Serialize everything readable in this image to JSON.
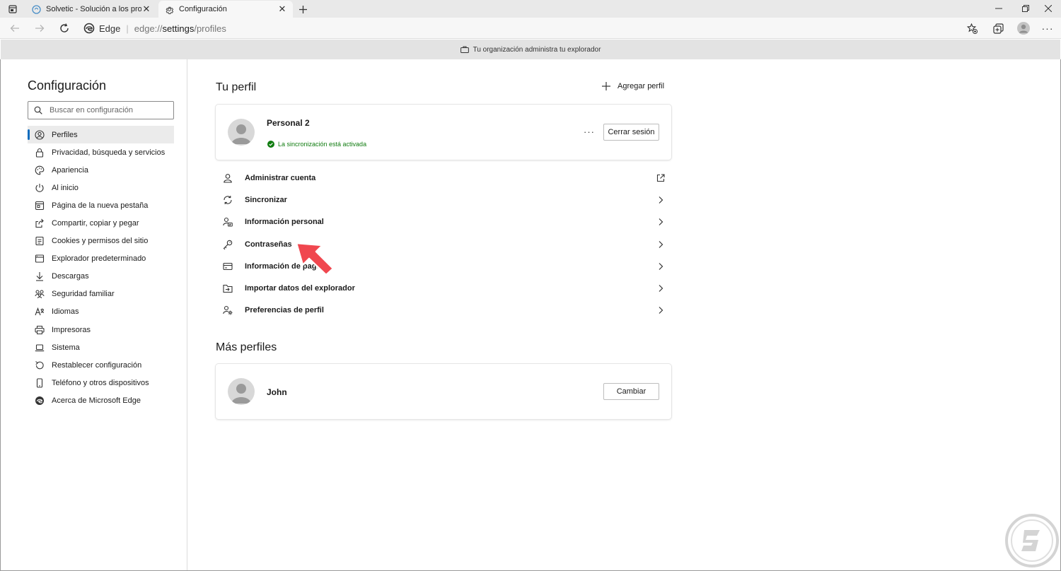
{
  "tabs": [
    {
      "title": "Solvetic - Solución a los problem",
      "active": false
    },
    {
      "title": "Configuración",
      "active": true
    }
  ],
  "toolbar": {
    "brand": "Edge",
    "url_prefix": "edge://",
    "url_host": "settings",
    "url_path": "/profiles"
  },
  "managed_bar": {
    "text": "Tu organización administra tu explorador"
  },
  "sidebar": {
    "title": "Configuración",
    "search_placeholder": "Buscar en configuración",
    "items": [
      {
        "label": "Perfiles",
        "icon": "profile-icon",
        "selected": true
      },
      {
        "label": "Privacidad, búsqueda y servicios",
        "icon": "lock-icon"
      },
      {
        "label": "Apariencia",
        "icon": "appearance-icon"
      },
      {
        "label": "Al inicio",
        "icon": "power-icon"
      },
      {
        "label": "Página de la nueva pestaña",
        "icon": "newtab-icon"
      },
      {
        "label": "Compartir, copiar y pegar",
        "icon": "share-icon"
      },
      {
        "label": "Cookies y permisos del sitio",
        "icon": "cookies-icon"
      },
      {
        "label": "Explorador predeterminado",
        "icon": "browser-icon"
      },
      {
        "label": "Descargas",
        "icon": "download-icon"
      },
      {
        "label": "Seguridad familiar",
        "icon": "family-icon"
      },
      {
        "label": "Idiomas",
        "icon": "languages-icon"
      },
      {
        "label": "Impresoras",
        "icon": "printer-icon"
      },
      {
        "label": "Sistema",
        "icon": "laptop-icon"
      },
      {
        "label": "Restablecer configuración",
        "icon": "reset-icon"
      },
      {
        "label": "Teléfono y otros dispositivos",
        "icon": "phone-icon"
      },
      {
        "label": "Acerca de Microsoft Edge",
        "icon": "edge-logo-icon"
      }
    ]
  },
  "main": {
    "profile_heading": "Tu perfil",
    "add_profile_label": "Agregar perfil",
    "current_profile": {
      "name": "Personal 2",
      "sync_status": "La sincronización está activada",
      "signout_label": "Cerrar sesión"
    },
    "rows": [
      {
        "label": "Administrar cuenta",
        "icon": "person-icon",
        "end": "external-link-icon"
      },
      {
        "label": "Sincronizar",
        "icon": "sync-icon",
        "end": "chevron-right-icon"
      },
      {
        "label": "Información personal",
        "icon": "personal-info-icon",
        "end": "chevron-right-icon"
      },
      {
        "label": "Contraseñas",
        "icon": "key-icon",
        "end": "chevron-right-icon"
      },
      {
        "label": "Información de pago",
        "icon": "card-icon",
        "end": "chevron-right-icon"
      },
      {
        "label": "Importar datos del explorador",
        "icon": "import-icon",
        "end": "chevron-right-icon"
      },
      {
        "label": "Preferencias de perfil",
        "icon": "profile-prefs-icon",
        "end": "chevron-right-icon"
      }
    ],
    "more_profiles_heading": "Más perfiles",
    "other_profile": {
      "name": "John",
      "switch_label": "Cambiar"
    }
  },
  "colors": {
    "accent": "#0f6cbd",
    "sync_green": "#107c10",
    "annotation_arrow": "#f0474f"
  }
}
